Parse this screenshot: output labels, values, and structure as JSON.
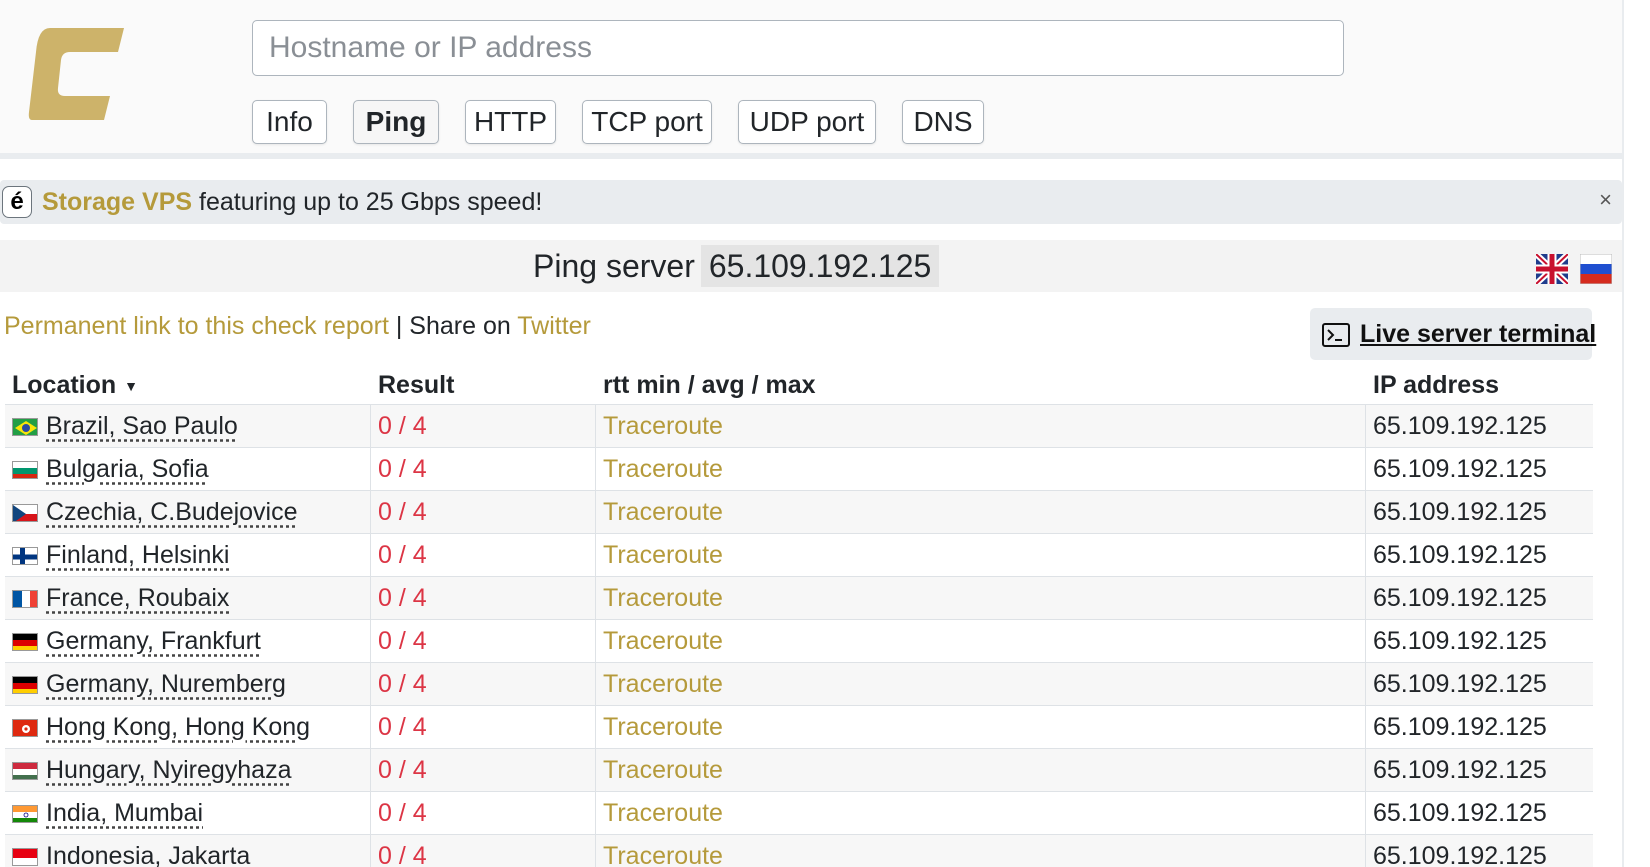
{
  "search": {
    "placeholder": "Hostname or IP address"
  },
  "tabs": [
    {
      "label": "Info",
      "active": false
    },
    {
      "label": "Ping",
      "active": true
    },
    {
      "label": "HTTP",
      "active": false
    },
    {
      "label": "TCP port",
      "active": false
    },
    {
      "label": "UDP port",
      "active": false
    },
    {
      "label": "DNS",
      "active": false
    }
  ],
  "banner": {
    "logo_letter": "é",
    "brand": "Storage VPS",
    "text": " featuring up to 25 Gbps speed!",
    "close": "×"
  },
  "title": {
    "prefix": "Ping server",
    "host": "65.109.192.125"
  },
  "links": {
    "permalink": "Permanent link to this check report",
    "separator": " | ",
    "share_on": "Share on ",
    "twitter": "Twitter"
  },
  "terminal_button": {
    "label": "Live server terminal",
    "icon": "terminal-icon"
  },
  "table": {
    "headers": {
      "location": "Location",
      "result": "Result",
      "rtt": "rtt min / avg / max",
      "ip": "IP address",
      "sort_indicator": "▼"
    },
    "rows": [
      {
        "flag": "br",
        "location": "Brazil, Sao Paulo",
        "result": "0 / 4",
        "rtt": "Traceroute",
        "ip": "65.109.192.125"
      },
      {
        "flag": "bg",
        "location": "Bulgaria, Sofia",
        "result": "0 / 4",
        "rtt": "Traceroute",
        "ip": "65.109.192.125"
      },
      {
        "flag": "cz",
        "location": "Czechia, C.Budejovice",
        "result": "0 / 4",
        "rtt": "Traceroute",
        "ip": "65.109.192.125"
      },
      {
        "flag": "fi",
        "location": "Finland, Helsinki",
        "result": "0 / 4",
        "rtt": "Traceroute",
        "ip": "65.109.192.125"
      },
      {
        "flag": "fr",
        "location": "France, Roubaix",
        "result": "0 / 4",
        "rtt": "Traceroute",
        "ip": "65.109.192.125"
      },
      {
        "flag": "de",
        "location": "Germany, Frankfurt",
        "result": "0 / 4",
        "rtt": "Traceroute",
        "ip": "65.109.192.125"
      },
      {
        "flag": "de",
        "location": "Germany, Nuremberg",
        "result": "0 / 4",
        "rtt": "Traceroute",
        "ip": "65.109.192.125"
      },
      {
        "flag": "hk",
        "location": "Hong Kong, Hong Kong",
        "result": "0 / 4",
        "rtt": "Traceroute",
        "ip": "65.109.192.125"
      },
      {
        "flag": "hu",
        "location": "Hungary, Nyiregyhaza",
        "result": "0 / 4",
        "rtt": "Traceroute",
        "ip": "65.109.192.125"
      },
      {
        "flag": "in",
        "location": "India, Mumbai",
        "result": "0 / 4",
        "rtt": "Traceroute",
        "ip": "65.109.192.125"
      },
      {
        "flag": "id",
        "location": "Indonesia, Jakarta",
        "result": "0 / 4",
        "rtt": "Traceroute",
        "ip": "65.109.192.125"
      }
    ]
  },
  "colors": {
    "accent": "#b59a3b",
    "fail": "#dc3545"
  }
}
